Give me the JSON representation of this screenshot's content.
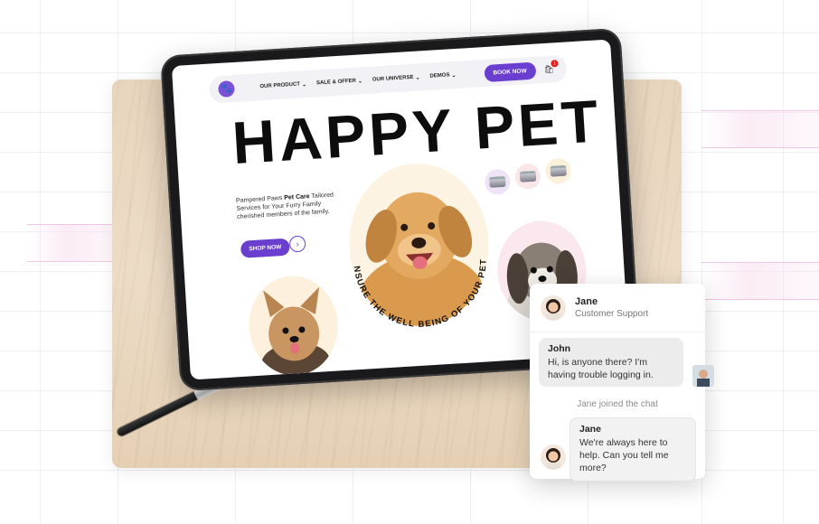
{
  "site": {
    "nav": {
      "items": [
        {
          "label": "OUR PRODUCT"
        },
        {
          "label": "SALE & OFFER"
        },
        {
          "label": "OUR UNIVERSE"
        },
        {
          "label": "DEMOS"
        }
      ],
      "book_label": "BOOK NOW",
      "cart_count": "1"
    },
    "hero": {
      "title": "HAPPY PET",
      "desc_prefix": "Pampered Paws ",
      "desc_bold": "Pet Care",
      "desc_rest": " Tailored Services for Your Furry Family cherished members of the family.",
      "shop_label": "SHOP NOW",
      "arc_text": "ENSURE THE WELL BEING OF YOUR PETS"
    }
  },
  "chat": {
    "agent": {
      "name": "Jane",
      "role": "Customer Support"
    },
    "messages": [
      {
        "sender": "John",
        "text": "Hi, is anyone there? I'm having trouble logging in."
      },
      {
        "sender": "Jane",
        "text": "We're always here to help. Can you tell me more?"
      }
    ],
    "system_note": "Jane joined the chat"
  },
  "colors": {
    "accent": "#6a3fd0",
    "badge": "#e02020"
  }
}
